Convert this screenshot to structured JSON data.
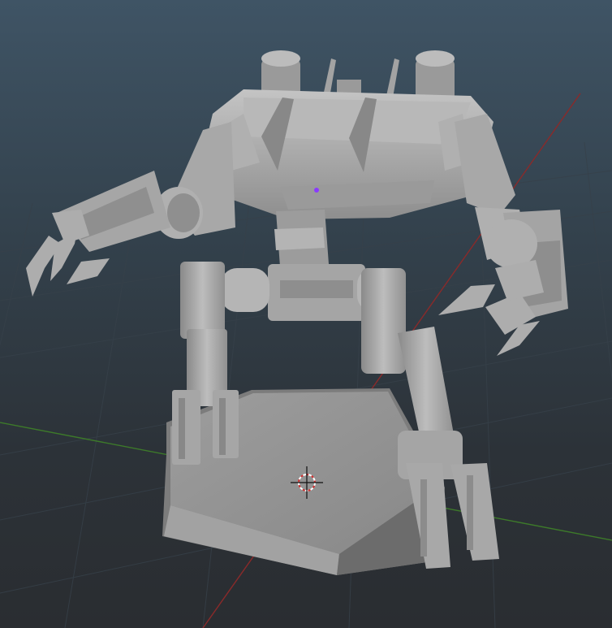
{
  "viewport": {
    "label": "3D viewport",
    "background_top": "#3f5465",
    "background_bottom": "#2a2d31"
  },
  "scene": {
    "grid_color": "#37414a",
    "x_axis_color": "#8a2a2a",
    "z_axis_color": "#3d7a2a",
    "model_color": "#a8a8a8",
    "model_shadow_color": "#6a6a6a",
    "selection_dot_color": "#8a3aff",
    "objects": [
      "mech-robot",
      "hex-base",
      "3d-cursor"
    ]
  }
}
